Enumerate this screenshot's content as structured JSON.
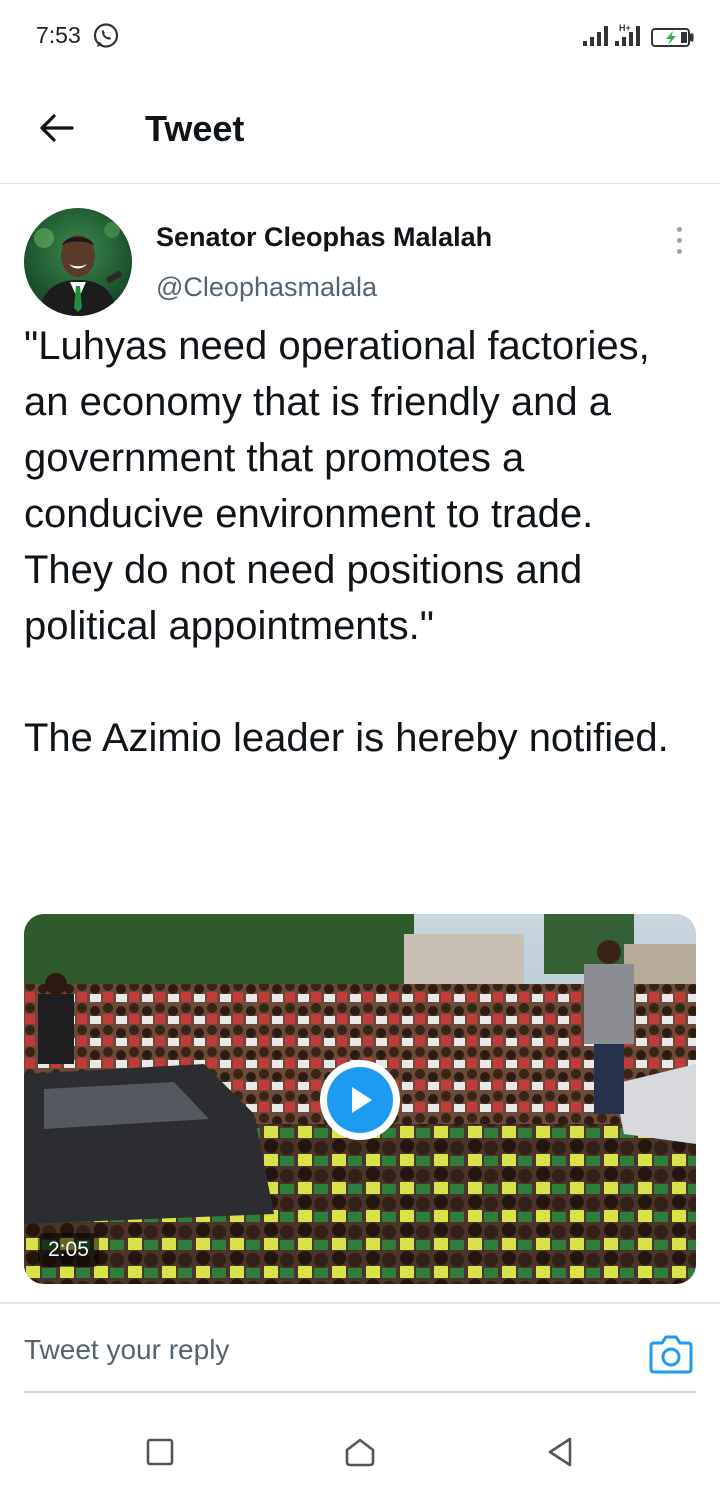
{
  "status_bar": {
    "time": "7:53",
    "notification_icon": "whatsapp-icon",
    "signal_icons": [
      "signal-icon",
      "signal-icon"
    ],
    "battery_icon": "battery-charging-icon",
    "network_badge": "H+"
  },
  "header": {
    "back_icon": "arrow-left-icon",
    "title": "Tweet"
  },
  "tweet": {
    "author_name": "Senator Cleophas Malalah",
    "author_handle": "@Cleophasmalala",
    "more_icon": "more-vertical-icon",
    "text": "\"Luhyas need operational factories, an economy that is friendly and a government that promotes a conducive environment to trade.\nThey do not need positions and political appointments.\"\n\nThe Azimio leader is hereby notified.",
    "media": {
      "type": "video",
      "duration": "2:05",
      "play_icon": "play-icon"
    }
  },
  "reply": {
    "placeholder": "Tweet your reply",
    "camera_icon": "camera-icon"
  },
  "nav_bar": {
    "recents_icon": "square-icon",
    "home_icon": "home-icon",
    "back_icon": "triangle-back-icon"
  },
  "colors": {
    "accent": "#1d9bf0",
    "text_primary": "#0f1419",
    "text_secondary": "#536471",
    "divider": "#dfe3e6"
  }
}
